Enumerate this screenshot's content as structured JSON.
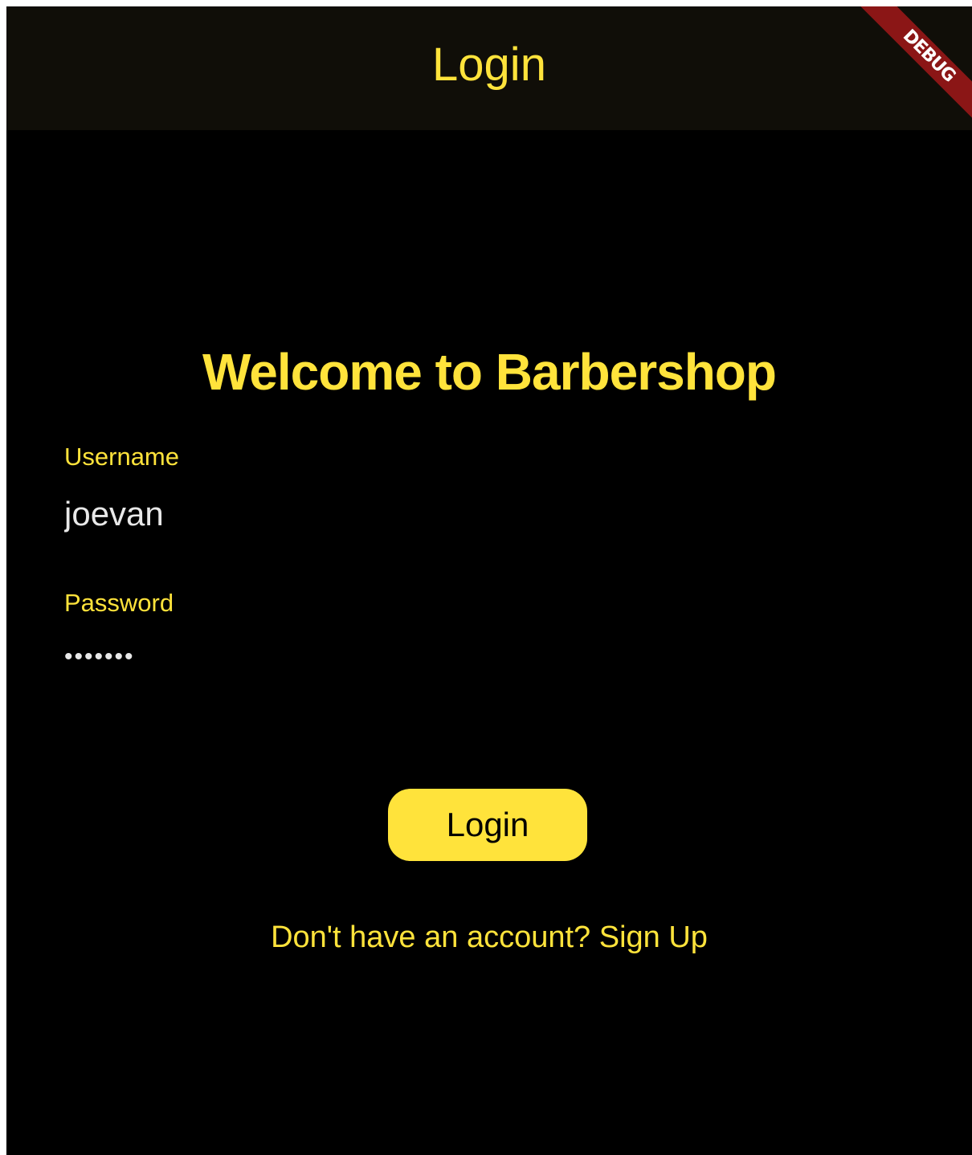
{
  "app_bar": {
    "title": "Login"
  },
  "debug_banner": {
    "label": "DEBUG"
  },
  "main": {
    "welcome_title": "Welcome to Barbershop",
    "username": {
      "label": "Username",
      "value": "joevan"
    },
    "password": {
      "label": "Password",
      "value": "•••••••"
    },
    "login_button_label": "Login",
    "signup_link": "Don't have an account? Sign Up"
  },
  "colors": {
    "accent": "#ffe33b",
    "background": "#000000",
    "app_bar_background": "#100e08",
    "debug_banner": "#8b1616",
    "input_text": "#e8e8e8"
  }
}
